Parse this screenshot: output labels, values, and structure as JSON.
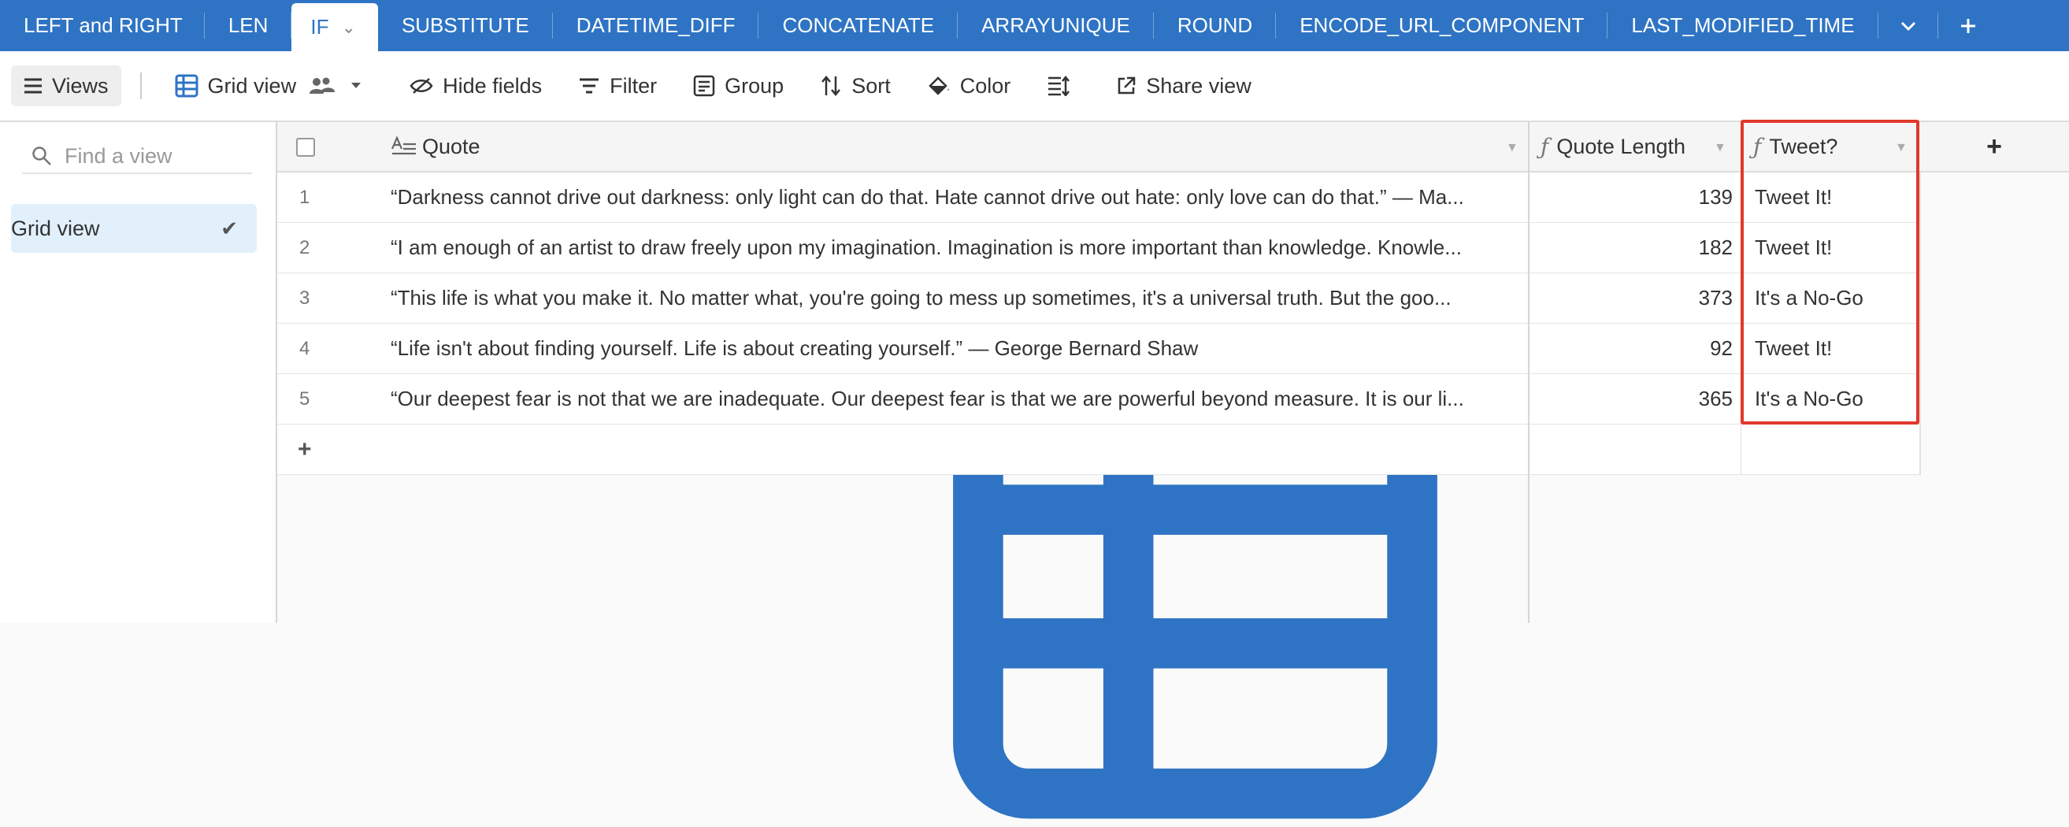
{
  "tabs": [
    {
      "label": "LEFT and RIGHT",
      "active": false
    },
    {
      "label": "LEN",
      "active": false
    },
    {
      "label": "IF",
      "active": true
    },
    {
      "label": "SUBSTITUTE",
      "active": false
    },
    {
      "label": "DATETIME_DIFF",
      "active": false
    },
    {
      "label": "CONCATENATE",
      "active": false
    },
    {
      "label": "ARRAYUNIQUE",
      "active": false
    },
    {
      "label": "ROUND",
      "active": false
    },
    {
      "label": "ENCODE_URL_COMPONENT",
      "active": false
    },
    {
      "label": "LAST_MODIFIED_TIME",
      "active": false
    }
  ],
  "toolbar": {
    "views_label": "Views",
    "grid_view_label": "Grid view",
    "hide_fields_label": "Hide fields",
    "filter_label": "Filter",
    "group_label": "Group",
    "sort_label": "Sort",
    "color_label": "Color",
    "share_view_label": "Share view"
  },
  "sidebar": {
    "search_placeholder": "Find a view",
    "views": [
      {
        "label": "Grid view",
        "selected": true
      }
    ]
  },
  "table": {
    "columns": {
      "quote": "Quote",
      "quote_length": "Quote Length",
      "tweet": "Tweet?"
    },
    "rows": [
      {
        "num": "1",
        "quote": "“Darkness cannot drive out darkness: only light can do that. Hate cannot drive out hate: only love can do that.” — Ma...",
        "length": "139",
        "tweet": "Tweet It!"
      },
      {
        "num": "2",
        "quote": "“I am enough of an artist to draw freely upon my imagination. Imagination is more important than knowledge. Knowle...",
        "length": "182",
        "tweet": "Tweet It!"
      },
      {
        "num": "3",
        "quote": "“This life is what you make it. No matter what, you're going to mess up sometimes, it's a universal truth. But the goo...",
        "length": "373",
        "tweet": "It's a No-Go"
      },
      {
        "num": "4",
        "quote": "“Life isn't about finding yourself. Life is about creating yourself.” — George Bernard Shaw",
        "length": "92",
        "tweet": "Tweet It!"
      },
      {
        "num": "5",
        "quote": "“Our deepest fear is not that we are inadequate. Our deepest fear is that we are powerful beyond measure. It is our li...",
        "length": "365",
        "tweet": "It's a No-Go"
      }
    ],
    "add_row_label": "+",
    "add_field_label": "+"
  },
  "colors": {
    "tabbar": "#2f74c4",
    "highlight": "#e0382c",
    "selected_view": "#e1f0fb"
  }
}
